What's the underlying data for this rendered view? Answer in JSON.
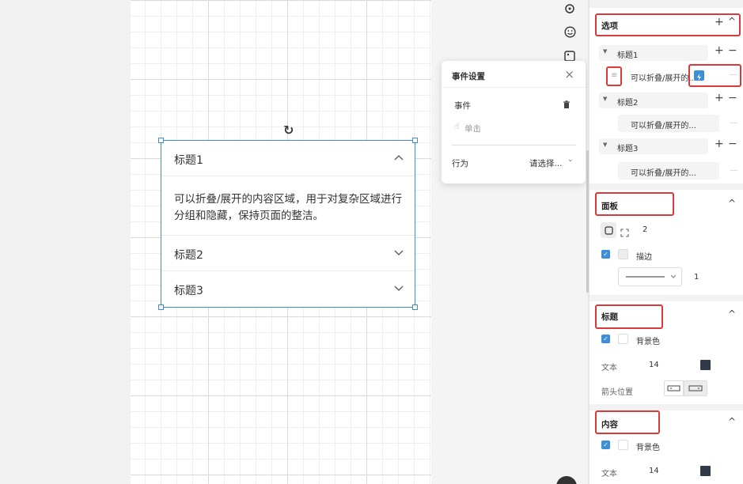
{
  "accordion": {
    "items": [
      {
        "title": "标题1",
        "chevron": "^"
      },
      {
        "title": "标题2",
        "chevron": "v"
      },
      {
        "title": "标题3",
        "chevron": "v"
      }
    ],
    "content": "可以折叠/展开的内容区域，用于对复杂区域进行分组和隐藏，保持页面的整洁。"
  },
  "event_popover": {
    "title": "事件设置",
    "close": "×",
    "event_label": "事件",
    "trigger": "单击",
    "action_label": "行为",
    "action_value": "请选择..."
  },
  "panel": {
    "options": {
      "title": "选项",
      "items": [
        {
          "title": "标题1",
          "content": "可以折叠/展开的..."
        },
        {
          "title": "标题2",
          "content": "可以折叠/展开的..."
        },
        {
          "title": "标题3",
          "content": "可以折叠/展开的..."
        }
      ],
      "menu_glyph": "≡"
    },
    "board": {
      "title": "面板",
      "radius": "2",
      "stroke_label": "描边",
      "stroke_width": "1"
    },
    "heading": {
      "title": "标题",
      "bg_label": "背景色",
      "text_label": "文本",
      "text_size": "14",
      "arrow_label": "箭头位置"
    },
    "content": {
      "title": "内容",
      "bg_label": "背景色",
      "text_label": "文本",
      "text_size": "14"
    },
    "colors": {
      "accent": "#3c8ed6",
      "highlight": "#d93a3a",
      "text_swatch": "#2f3b4a"
    }
  }
}
